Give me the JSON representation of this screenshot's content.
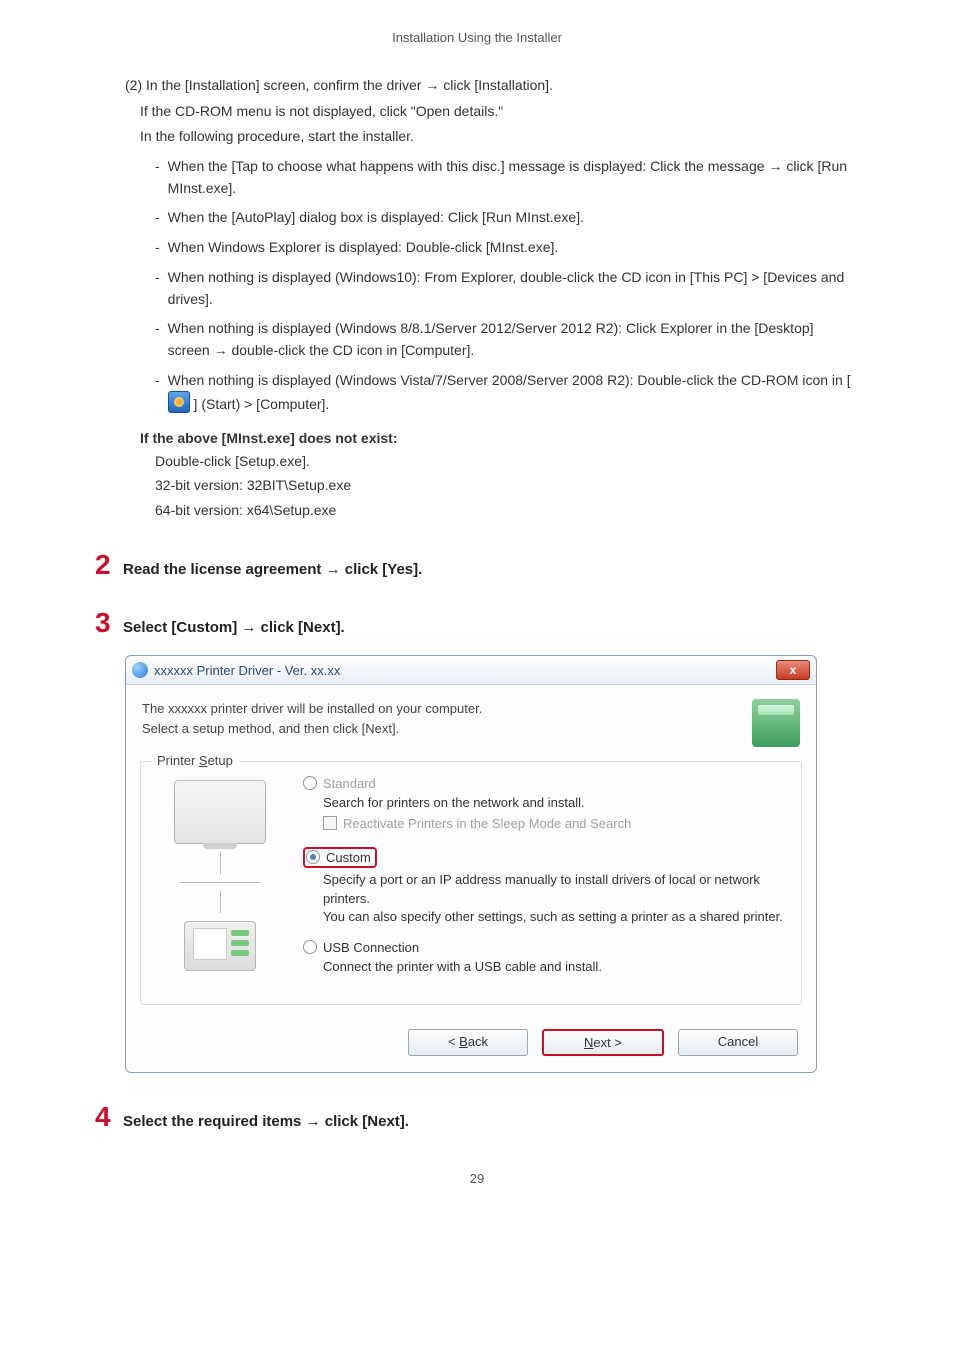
{
  "header": "Installation Using the Installer",
  "section": {
    "line1_pre": "(2) In the [Installation] screen, confirm the driver ",
    "line1_post": " click [Installation].",
    "line2": "If the CD-ROM menu is not displayed, click \"Open details.\"",
    "line3": "In the following procedure, start the installer.",
    "bullets": [
      {
        "pre": "When the [Tap to choose what happens with this disc.] message is displayed: Click the message ",
        "post": " click [Run MInst.exe]."
      },
      {
        "text": "When the [AutoPlay] dialog box is displayed: Click [Run MInst.exe]."
      },
      {
        "text": "When Windows Explorer is displayed: Double-click [MInst.exe]."
      },
      {
        "text": "When nothing is displayed (Windows10): From Explorer, double-click the CD icon in [This PC] > [Devices and drives]."
      },
      {
        "pre": "When nothing is displayed (Windows 8/8.1/Server 2012/Server 2012 R2): Click Explorer in the [Desktop] screen ",
        "post": " double-click the CD icon in [Computer]."
      },
      {
        "text_pre": "When nothing is displayed (Windows Vista/7/Server 2008/Server 2008 R2): Double-click the CD-ROM icon in [ ",
        "text_post": " ] (Start) > [Computer]."
      }
    ],
    "note_title": "If the above [MInst.exe] does not exist:",
    "note_lines": [
      "Double-click [Setup.exe].",
      "32-bit version: 32BIT\\Setup.exe",
      "64-bit version: x64\\Setup.exe"
    ]
  },
  "steps": {
    "s2_num": "2",
    "s2_pre": "Read the license agreement ",
    "s2_post": " click [Yes].",
    "s3_num": "3",
    "s3_pre": "Select [Custom] ",
    "s3_post": " click [Next].",
    "s4_num": "4",
    "s4_pre": "Select the required items ",
    "s4_post": " click [Next]."
  },
  "dialog": {
    "title": "xxxxxx Printer Driver - Ver. xx.xx",
    "close": "x",
    "head1": "The xxxxxx printer driver will be installed on your computer.",
    "head2": "Select a setup method, and then click [Next].",
    "group_label": "Printer Setup",
    "standard": {
      "label": "Standard",
      "desc": "Search for printers on the network and install.",
      "chk_label": "Reactivate Printers in the Sleep Mode and Search"
    },
    "custom": {
      "label": "Custom",
      "desc": "Specify a port or an IP address manually to install drivers of local or network printers.\nYou can also specify other settings, such as setting a printer as a shared printer."
    },
    "usb": {
      "label": "USB Connection",
      "desc": "Connect the printer with a USB cable and install."
    },
    "buttons": {
      "back": "< Back",
      "next": "Next >",
      "cancel": "Cancel"
    }
  },
  "arrow": "→",
  "page_number": "29"
}
